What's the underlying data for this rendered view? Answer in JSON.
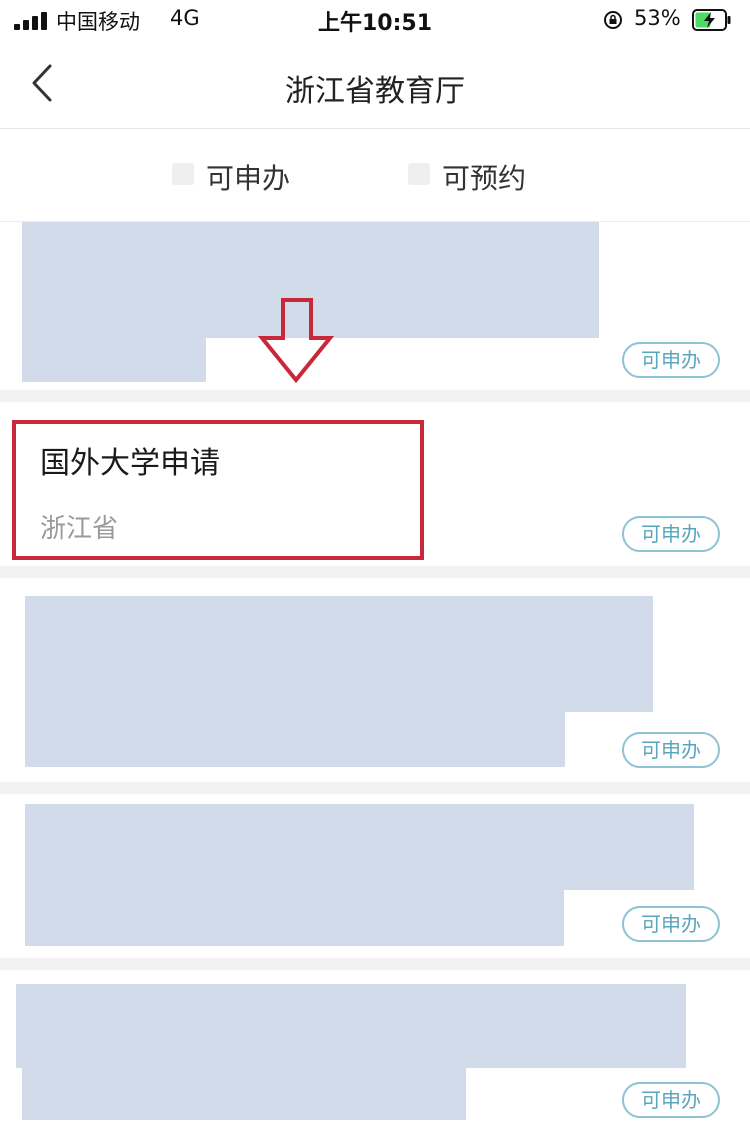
{
  "status_bar": {
    "carrier": "中国移动",
    "network": "4G",
    "time": "上午10:51",
    "battery_percent": "53%",
    "battery_level": 0.53
  },
  "nav": {
    "title": "浙江省教育厅"
  },
  "filters": [
    {
      "label": "可申办",
      "checked": false
    },
    {
      "label": "可预约",
      "checked": false
    }
  ],
  "items": [
    {
      "badge": "可申办"
    },
    {
      "title": "国外大学申请",
      "region": "浙江省",
      "badge": "可申办"
    },
    {
      "badge": "可申办"
    },
    {
      "badge": "可申办"
    },
    {
      "badge": "可申办"
    }
  ],
  "colors": {
    "highlight": "#c8283a",
    "badge_border": "#8dc3d3",
    "badge_text": "#5aa6bd",
    "redacted": "#d1dbe9"
  }
}
